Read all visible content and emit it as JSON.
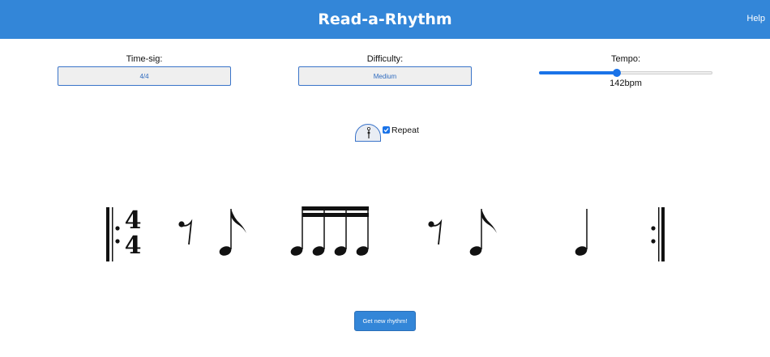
{
  "header": {
    "title": "Read-a-Rhythm",
    "help_label": "Help",
    "color": "#3386d8"
  },
  "controls": {
    "time_signature": {
      "label": "Time-sig:",
      "value": "4/4"
    },
    "difficulty": {
      "label": "Difficulty:",
      "value": "Medium"
    },
    "tempo": {
      "label": "Tempo:",
      "bpm": 142,
      "readout": "142bpm",
      "level_fraction": 0.45
    }
  },
  "metronome": {
    "icon": "metronome-icon",
    "repeat_checked": true,
    "repeat_label": "Repeat"
  },
  "rhythm": {
    "time_signature": {
      "top": "4",
      "bottom": "4"
    },
    "start_barline": "repeat-start",
    "end_barline": "repeat-end",
    "beats": [
      {
        "notes": [
          "eighth-rest",
          "eighth-note"
        ]
      },
      {
        "notes": [
          "sixteenth-note",
          "sixteenth-note",
          "sixteenth-note",
          "sixteenth-note"
        ]
      },
      {
        "notes": [
          "eighth-rest",
          "eighth-note"
        ]
      },
      {
        "notes": [
          "quarter-note"
        ]
      }
    ]
  },
  "actions": {
    "new_rhythm_label": "Get new rhythm!",
    "accent_color": "#3386d8"
  }
}
